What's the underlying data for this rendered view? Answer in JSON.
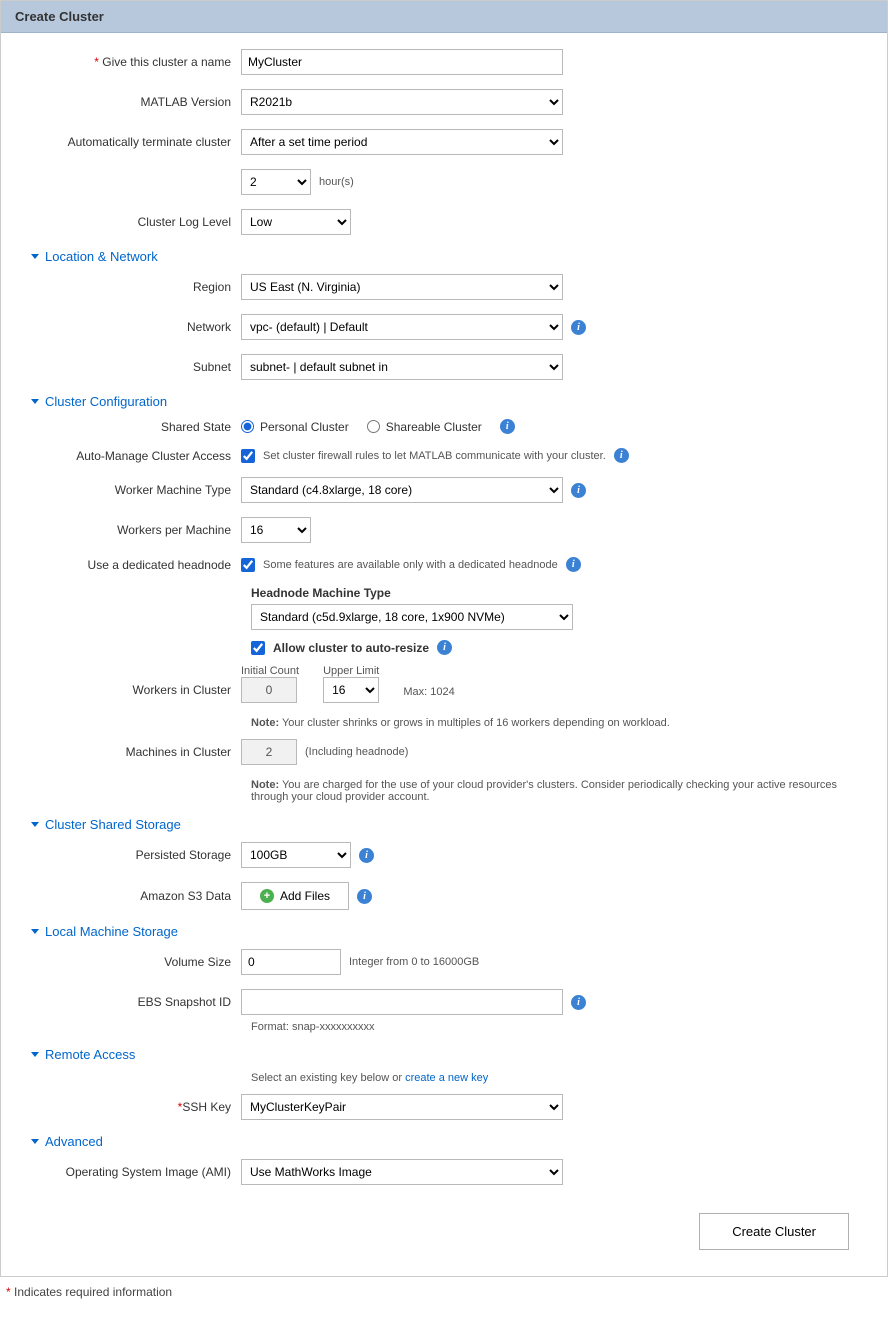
{
  "header": {
    "title": "Create Cluster"
  },
  "basic": {
    "name_label": "Give this cluster a name",
    "name_value": "MyCluster",
    "matlab_label": "MATLAB Version",
    "matlab_value": "R2021b",
    "auto_term_label": "Automatically terminate cluster",
    "auto_term_value": "After a set time period",
    "hours_value": "2",
    "hours_suffix": "hour(s)",
    "log_label": "Cluster Log Level",
    "log_value": "Low"
  },
  "loc": {
    "section": "Location & Network",
    "region_label": "Region",
    "region_value": "US East (N. Virginia)",
    "network_label": "Network",
    "network_value": "vpc-                              (default) | Default",
    "subnet_label": "Subnet",
    "subnet_value": "subnet-                             | default subnet in"
  },
  "cfg": {
    "section": "Cluster Configuration",
    "shared_label": "Shared State",
    "shared_personal": "Personal Cluster",
    "shared_shareable": "Shareable Cluster",
    "auto_manage_label": "Auto-Manage Cluster Access",
    "auto_manage_desc": "Set cluster firewall rules to let MATLAB communicate with your cluster.",
    "worker_type_label": "Worker Machine Type",
    "worker_type_value": "Standard (c4.8xlarge, 18 core)",
    "wpm_label": "Workers per Machine",
    "wpm_value": "16",
    "headnode_label": "Use a dedicated headnode",
    "headnode_desc": "Some features are available only with a dedicated headnode",
    "headnode_type_label": "Headnode Machine Type",
    "headnode_type_value": "Standard (c5d.9xlarge, 18 core, 1x900 NVMe)",
    "autoresize_label": "Allow cluster to auto-resize",
    "wic_label": "Workers in Cluster",
    "initial_label": "Initial Count",
    "initial_value": "0",
    "upper_label": "Upper Limit",
    "upper_value": "16",
    "max_label": "Max: 1024",
    "wic_note_prefix": "Note:",
    "wic_note": " Your cluster shrinks or grows in multiples of 16 workers depending on workload.",
    "mic_label": "Machines in Cluster",
    "mic_value": "2",
    "mic_suffix": "(Including headnode)",
    "mic_note": " You are charged for the use of your cloud provider's clusters. Consider periodically checking your active resources through your cloud provider account."
  },
  "storage": {
    "section": "Cluster Shared Storage",
    "persist_label": "Persisted Storage",
    "persist_value": "100GB",
    "s3_label": "Amazon S3 Data",
    "s3_btn": "Add Files"
  },
  "local": {
    "section": "Local Machine Storage",
    "vol_label": "Volume Size",
    "vol_value": "0",
    "vol_hint": "Integer from 0 to 16000GB",
    "ebs_label": "EBS Snapshot ID",
    "ebs_value": "",
    "ebs_hint": "Format: snap-xxxxxxxxxx"
  },
  "remote": {
    "section": "Remote Access",
    "hint_prefix": "Select an existing key below or ",
    "hint_link": "create a new key",
    "ssh_label": "SSH Key",
    "ssh_value": "MyClusterKeyPair"
  },
  "adv": {
    "section": "Advanced",
    "ami_label": "Operating System Image (AMI)",
    "ami_value": "Use MathWorks Image"
  },
  "footer": {
    "create_btn": "Create Cluster",
    "req_note": "Indicates required information"
  }
}
